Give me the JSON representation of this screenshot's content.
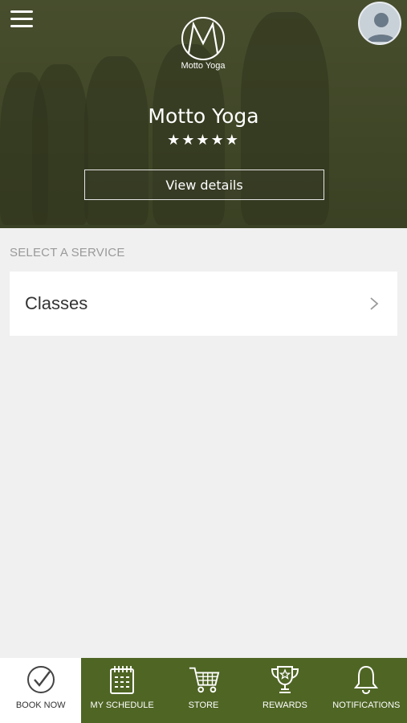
{
  "header": {
    "logo_text": "Motto Yoga",
    "studio_name": "Motto Yoga",
    "rating_stars": "★★★★★",
    "rating_value": 5,
    "view_details_label": "View details"
  },
  "services": {
    "section_label": "SELECT A SERVICE",
    "items": [
      {
        "label": "Classes"
      }
    ]
  },
  "tabbar": {
    "active_color": "#ffffff",
    "bar_color": "#4f6524",
    "tabs": [
      {
        "label": "BOOK NOW",
        "icon": "check-circle-icon",
        "active": true
      },
      {
        "label": "MY SCHEDULE",
        "icon": "calendar-icon",
        "active": false
      },
      {
        "label": "STORE",
        "icon": "cart-icon",
        "active": false
      },
      {
        "label": "REWARDS",
        "icon": "trophy-icon",
        "active": false
      },
      {
        "label": "NOTIFICATIONS",
        "icon": "bell-icon",
        "active": false
      }
    ]
  }
}
